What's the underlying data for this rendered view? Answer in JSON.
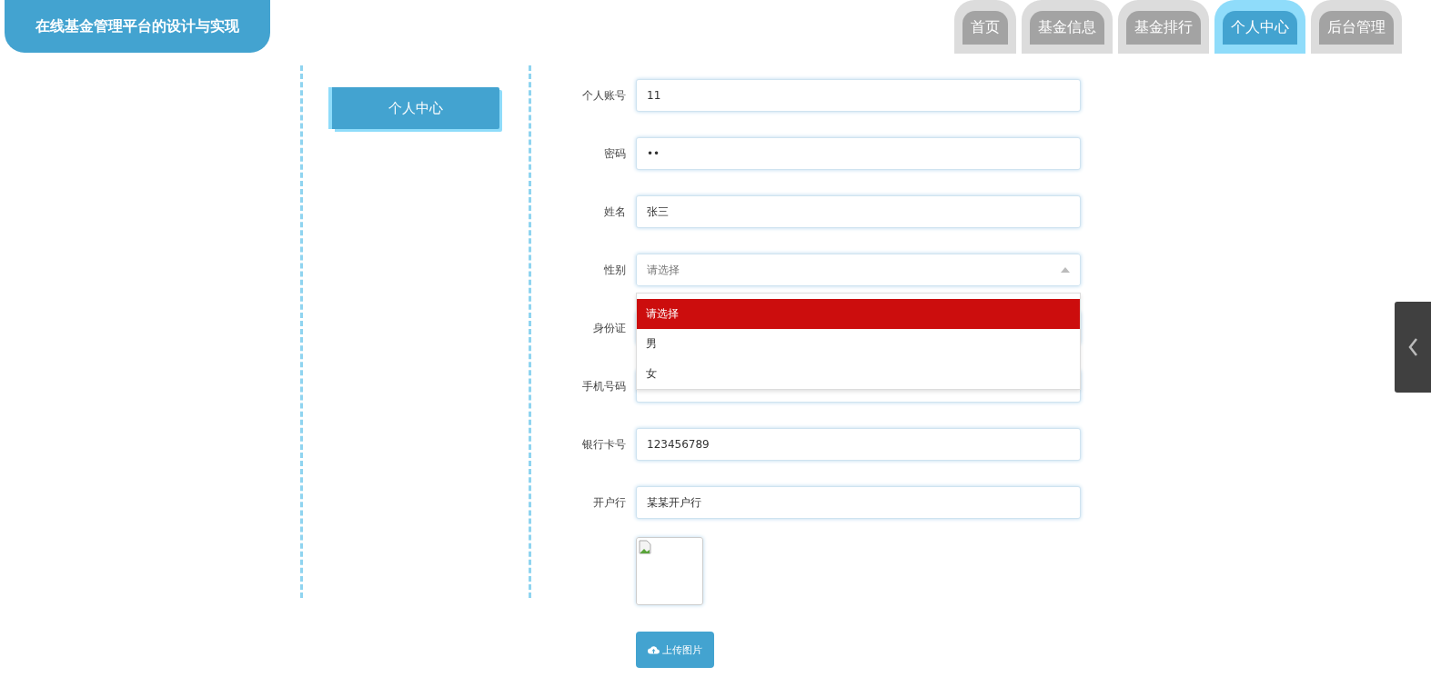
{
  "header": {
    "title": "在线基金管理平台的设计与实现"
  },
  "nav_tabs": [
    {
      "label": "首页",
      "selected": false
    },
    {
      "label": "基金信息",
      "selected": false
    },
    {
      "label": "基金排行",
      "selected": false
    },
    {
      "label": "个人中心",
      "selected": true
    },
    {
      "label": "后台管理",
      "selected": false
    }
  ],
  "sidebar": {
    "items": [
      {
        "label": "个人中心",
        "selected": true
      }
    ]
  },
  "form": {
    "fields": [
      {
        "kind": "text",
        "label": "个人账号",
        "value": "11"
      },
      {
        "kind": "password",
        "label": "密码",
        "value": "••"
      },
      {
        "kind": "text",
        "label": "姓名",
        "value": "张三"
      },
      {
        "kind": "select",
        "label": "性别",
        "placeholder": "请选择",
        "expanded": true,
        "options": [
          {
            "label": "请选择",
            "selected": true
          },
          {
            "label": "男",
            "selected": false
          },
          {
            "label": "女",
            "selected": false
          }
        ]
      },
      {
        "kind": "text",
        "label": "身份证"
      },
      {
        "kind": "text",
        "label": "手机号码"
      },
      {
        "kind": "text",
        "label": "银行卡号",
        "value": "123456789"
      },
      {
        "kind": "text",
        "label": "开户行",
        "value": "某某开户行"
      }
    ],
    "upload_button": "上传图片"
  }
}
